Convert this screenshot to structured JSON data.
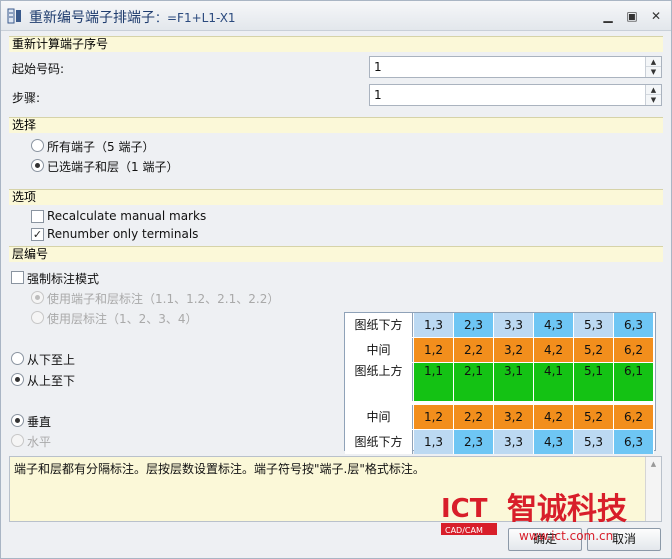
{
  "window": {
    "title": "重新编号端子排端子",
    "title_suffix": "：=F1+L1-X1",
    "minimize_glyph": "▁",
    "maximize_glyph": "▣",
    "close_glyph": "✕"
  },
  "recalc": {
    "header": "重新计算端子序号",
    "start_label": "起始号码:",
    "start_value": "1",
    "step_label": "步骤:",
    "step_value": "1"
  },
  "selection": {
    "header": "选择",
    "all_label": "所有端子（5 端子）",
    "selected_label": "已选端子和层（1 端子）",
    "selected": "selected"
  },
  "options": {
    "header": "选项",
    "recalc_label": "Recalculate manual marks",
    "recalc_checked": false,
    "renumber_label": "Renumber only terminals",
    "renumber_checked": true,
    "check_glyph": "✓"
  },
  "level": {
    "header": "层编号",
    "force_label": "强制标注模式",
    "force_checked": false,
    "use_both_label": "使用端子和层标注（1.1、1.2、2.1、2.2）",
    "use_level_label": "使用层标注（1、2、3、4）",
    "bottom_up_label": "从下至上",
    "top_down_label": "从上至下",
    "direction": "top_down",
    "vertical_label": "垂直",
    "horizontal_label": "水平",
    "orientation": "vertical"
  },
  "preview": {
    "colors": {
      "blue": "#6ec6f4",
      "orange": "#f28e1c",
      "green": "#14c214",
      "light": "#bcd9f2"
    },
    "rows": [
      {
        "label": "图纸下方",
        "color": "blue",
        "cells": [
          "1,3",
          "2,3",
          "3,3",
          "4,3",
          "5,3",
          "6,3"
        ]
      },
      {
        "label": "中间",
        "color": "orange",
        "cells": [
          "1,2",
          "2,2",
          "3,2",
          "4,2",
          "5,2",
          "6,2"
        ]
      },
      {
        "label": "图纸上方",
        "color": "green",
        "cells": [
          "1,1",
          "2,1",
          "3,1",
          "4,1",
          "5,1",
          "6,1"
        ]
      },
      {
        "label": "中间",
        "color": "orange",
        "cells": [
          "1,2",
          "2,2",
          "3,2",
          "4,2",
          "5,2",
          "6,2"
        ]
      },
      {
        "label": "图纸下方",
        "color": "blue",
        "cells": [
          "1,3",
          "2,3",
          "3,3",
          "4,3",
          "5,3",
          "6,3"
        ]
      }
    ]
  },
  "description": "端子和层都有分隔标注。层按层数设置标注。端子符号按\"端子.层\"格式标注。",
  "buttons": {
    "ok_label": "确定",
    "cancel_label": "取消"
  },
  "watermark": {
    "logo": "ICT",
    "logo_sub": "CAD/CAM",
    "company": "智诚科技",
    "url": "www.ict.com.cn"
  }
}
